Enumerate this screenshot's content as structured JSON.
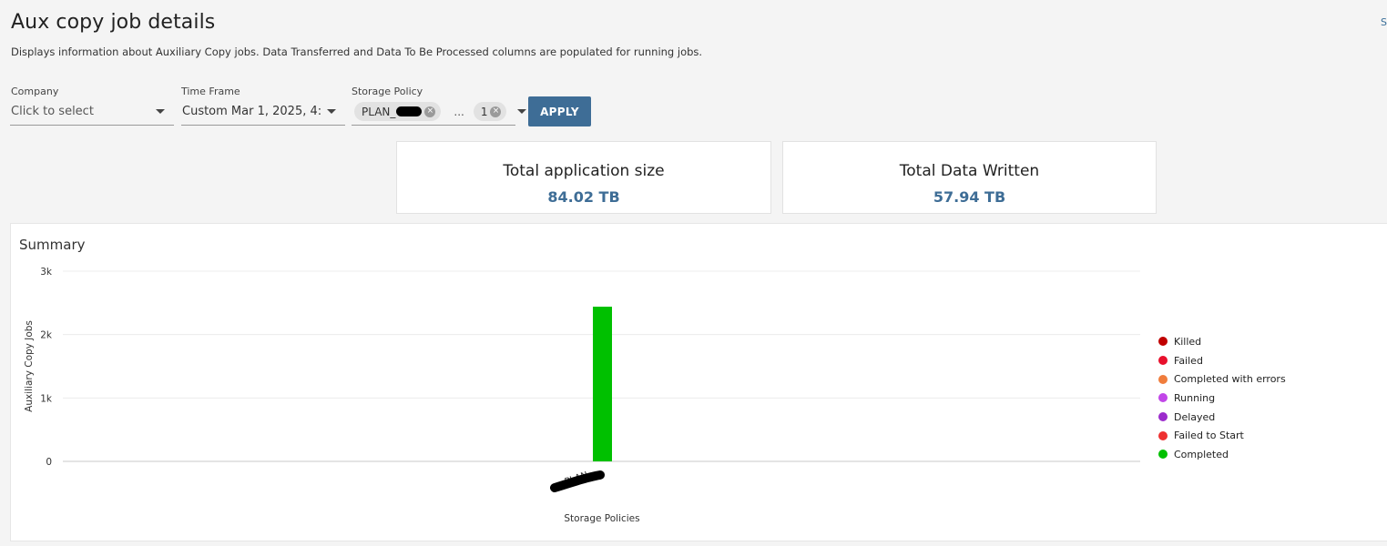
{
  "header": {
    "title": "Aux copy job details",
    "description": "Displays information about Auxiliary Copy jobs. Data Transferred and Data To Be Processed columns are populated for running jobs.",
    "corner_link": "S"
  },
  "filters": {
    "company": {
      "label": "Company",
      "placeholder": "Click to select"
    },
    "time_frame": {
      "label": "Time Frame",
      "value": "Custom Mar 1, 2025, 4:5..."
    },
    "storage_policy": {
      "label": "Storage Policy",
      "chip_label": "PLAN_",
      "more": "...",
      "count_chip": "1"
    },
    "apply_label": "APPLY"
  },
  "kpis": {
    "application_size": {
      "title": "Total application size",
      "value": "84.02 TB"
    },
    "data_written": {
      "title": "Total Data Written",
      "value": "57.94 TB"
    }
  },
  "summary": {
    "title": "Summary"
  },
  "chart_data": {
    "type": "bar",
    "stacked": true,
    "categories": [
      "PLAN_..."
    ],
    "xlabel": "Storage Policies",
    "ylabel": "Auxiliary Copy Jobs",
    "ylim": [
      0,
      3000
    ],
    "yticks": [
      0,
      1000,
      2000,
      3000
    ],
    "ytick_labels": [
      "0",
      "1k",
      "2k",
      "3k"
    ],
    "grid": true,
    "legend_position": "right",
    "series": [
      {
        "name": "Killed",
        "color": "#c00000",
        "values": [
          0
        ]
      },
      {
        "name": "Failed",
        "color": "#e8102c",
        "values": [
          0
        ]
      },
      {
        "name": "Completed with errors",
        "color": "#f07d3c",
        "values": [
          0
        ]
      },
      {
        "name": "Running",
        "color": "#c146e8",
        "values": [
          0
        ]
      },
      {
        "name": "Delayed",
        "color": "#9b2bcc",
        "values": [
          0
        ]
      },
      {
        "name": "Failed to Start",
        "color": "#ee3030",
        "values": [
          0
        ]
      },
      {
        "name": "Completed",
        "color": "#00c000",
        "values": [
          2440
        ]
      }
    ]
  }
}
